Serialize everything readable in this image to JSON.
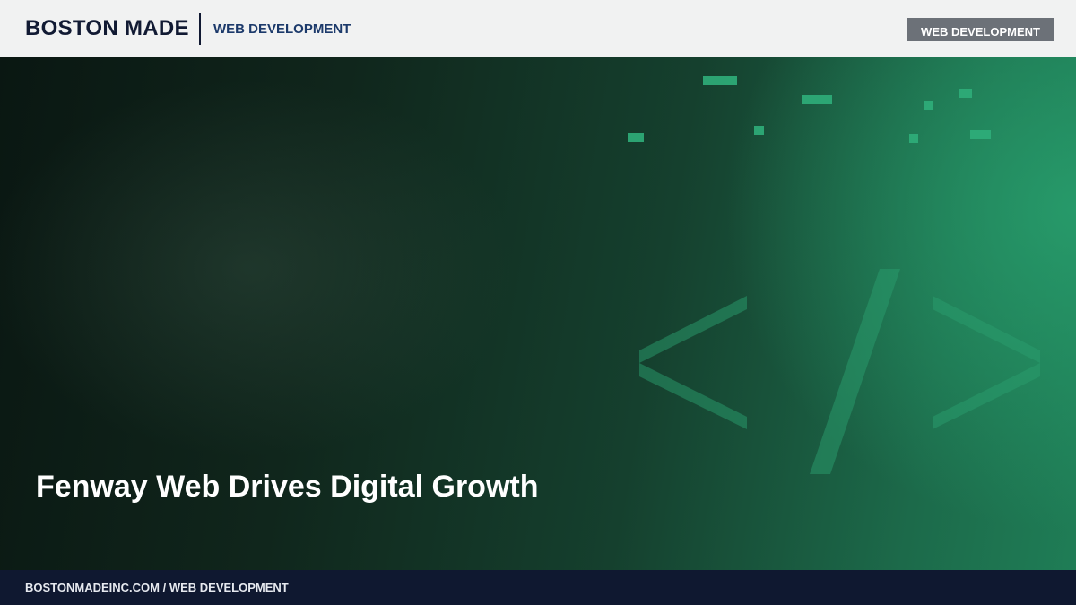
{
  "header": {
    "brand": "BOSTON MADE",
    "section": "WEB DEVELOPMENT",
    "badge": "WEB DEVELOPMENT"
  },
  "hero": {
    "headline": "Fenway Web Drives Digital Growth",
    "illustration": "code-brackets-icon",
    "accent_color": "#2a9d6e"
  },
  "footer": {
    "text": "BOSTONMADEINC.COM / WEB DEVELOPMENT"
  }
}
